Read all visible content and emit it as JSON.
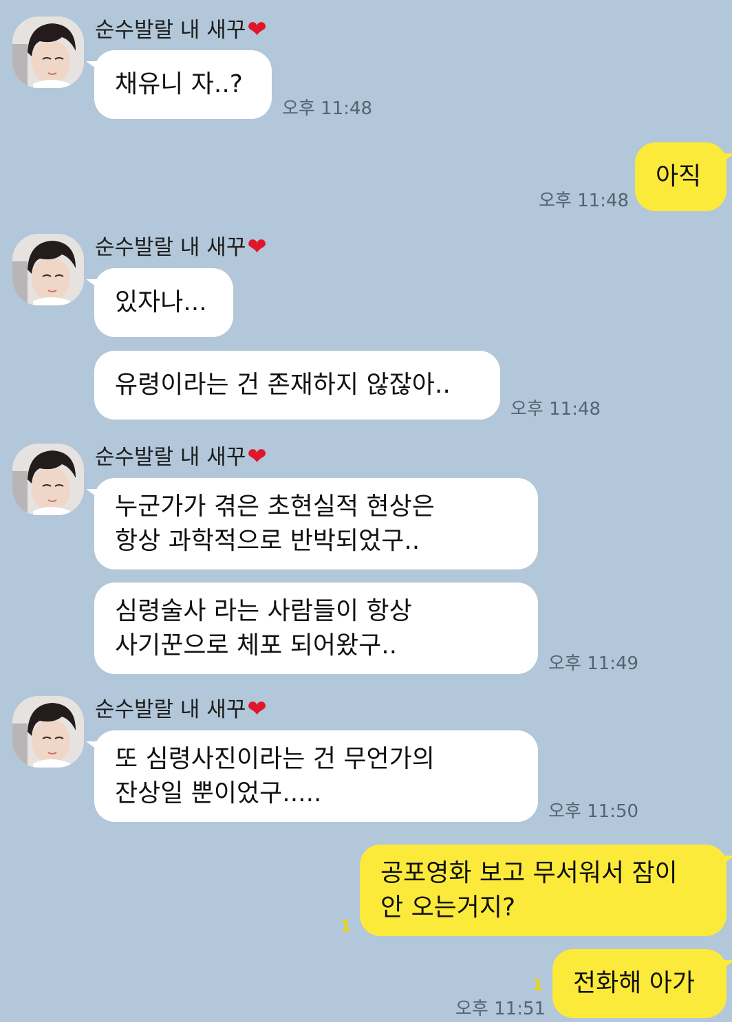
{
  "sender": {
    "name": "순수발랄 내 새꾸",
    "heart": "❤"
  },
  "messages": [
    {
      "from": "them",
      "lines": [
        "채유니 자..?"
      ],
      "time": "오후 11:48"
    },
    {
      "from": "me",
      "lines": [
        "아직"
      ],
      "time": "오후 11:48"
    },
    {
      "from": "them",
      "lines": [
        "있자나..."
      ]
    },
    {
      "from": "them",
      "lines": [
        "유령이라는 건 존재하지 않잖아.."
      ],
      "time": "오후 11:48"
    },
    {
      "from": "them",
      "lines": [
        "누군가가 겪은 초현실적 현상은",
        "항상 과학적으로 반박되었구.."
      ]
    },
    {
      "from": "them",
      "lines": [
        "심령술사 라는 사람들이 항상",
        "사기꾼으로 체포 되어왔구.."
      ],
      "time": "오후 11:49"
    },
    {
      "from": "them",
      "lines": [
        "또 심령사진이라는 건 무언가의",
        "잔상일 뿐이었구....."
      ],
      "time": "오후 11:50"
    },
    {
      "from": "me",
      "lines": [
        "공포영화 보고 무서워서 잠이",
        "안 오는거지?"
      ],
      "unread": "1"
    },
    {
      "from": "me",
      "lines": [
        "전화해 아가"
      ],
      "unread": "1",
      "time": "오후 11:51"
    }
  ],
  "colors": {
    "background": "#b2c7d9",
    "mine": "#fcea3a",
    "theirs": "#ffffff",
    "heart": "#e0162b"
  },
  "icons": {
    "avatar": "profile-photo",
    "heart": "red-heart-emoji"
  }
}
